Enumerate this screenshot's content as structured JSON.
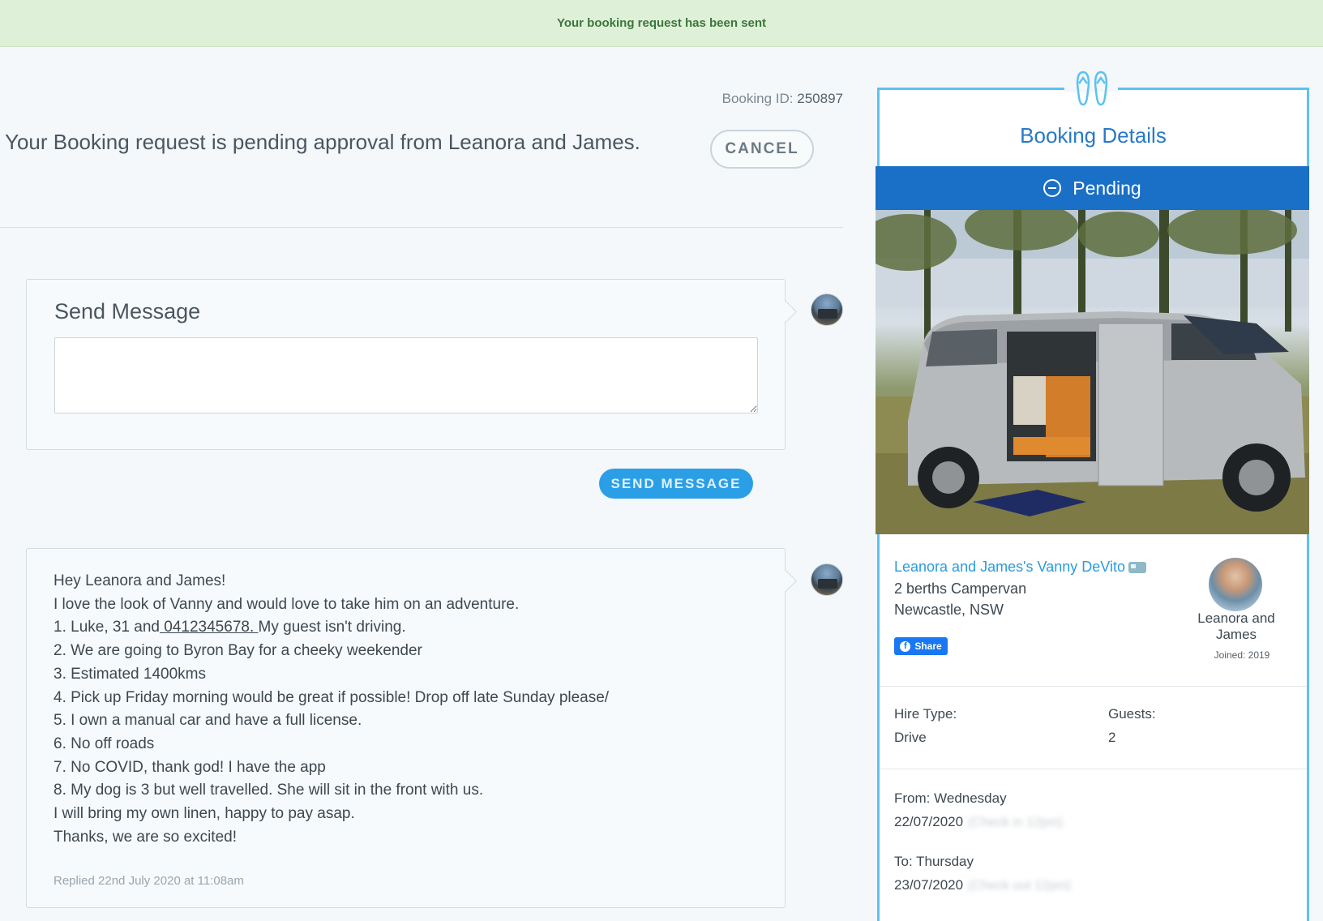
{
  "banner": {
    "text": "Your booking request has been sent"
  },
  "booking": {
    "id_label": "Booking ID:",
    "id_value": "250897",
    "status_message": "Your Booking request is pending approval from Leanora and James.",
    "cancel_label": "CANCEL"
  },
  "send_message": {
    "title": "Send Message",
    "textarea_value": "",
    "button_label": "SEND MESSAGE"
  },
  "message": {
    "line1": "Hey Leanora and James!",
    "line2": "I love the look of Vanny and would love to take him on an adventure.",
    "line3_pre": "1. Luke, 31 and",
    "line3_phone": " 0412345678. ",
    "line3_post": "My guest isn't driving.",
    "line4": "2. We are going to Byron Bay for a cheeky weekender",
    "line5": "3. Estimated 1400kms",
    "line6": "4. Pick up Friday morning would be great if possible! Drop off late Sunday please/",
    "line7": "5. I own a manual car and have a full license.",
    "line8": "6. No off roads",
    "line9": "7. No COVID, thank god! I have the app",
    "line10": "8. My dog is 3 but well travelled. She will sit in the front with us.",
    "line11": "I will bring my own linen, happy to pay asap.",
    "line12": "Thanks, we are so excited!",
    "replied": "Replied 22nd July 2020 at 11:08am"
  },
  "panel": {
    "title": "Booking Details",
    "status": "Pending",
    "vehicle_name": "Leanora and James's Vanny DeVito",
    "vehicle_type": "2 berths Campervan",
    "location": "Newcastle, NSW",
    "share_label": "Share",
    "host_name": "Leanora and James",
    "host_joined": "Joined: 2019",
    "hire_type_label": "Hire Type:",
    "hire_type_value": "Drive",
    "guests_label": "Guests:",
    "guests_value": "2",
    "from_label": "From:",
    "from_day": "Wednesday",
    "from_date": "22/07/2020",
    "from_note": "(Check in 12pm)",
    "to_label": "To:",
    "to_day": "Thursday",
    "to_date": "23/07/2020",
    "to_note": "(Check out 12pm)"
  },
  "colors": {
    "accent_blue": "#1a6fc6",
    "link_blue": "#2a9be0",
    "success_bg": "#dff0d8",
    "success_text": "#3c763d",
    "panel_border": "#5cc2f0"
  },
  "icons": {
    "panel_header": "flip-flops-icon",
    "status": "minus-circle-icon",
    "share": "facebook-icon",
    "vehicle": "van-icon"
  }
}
